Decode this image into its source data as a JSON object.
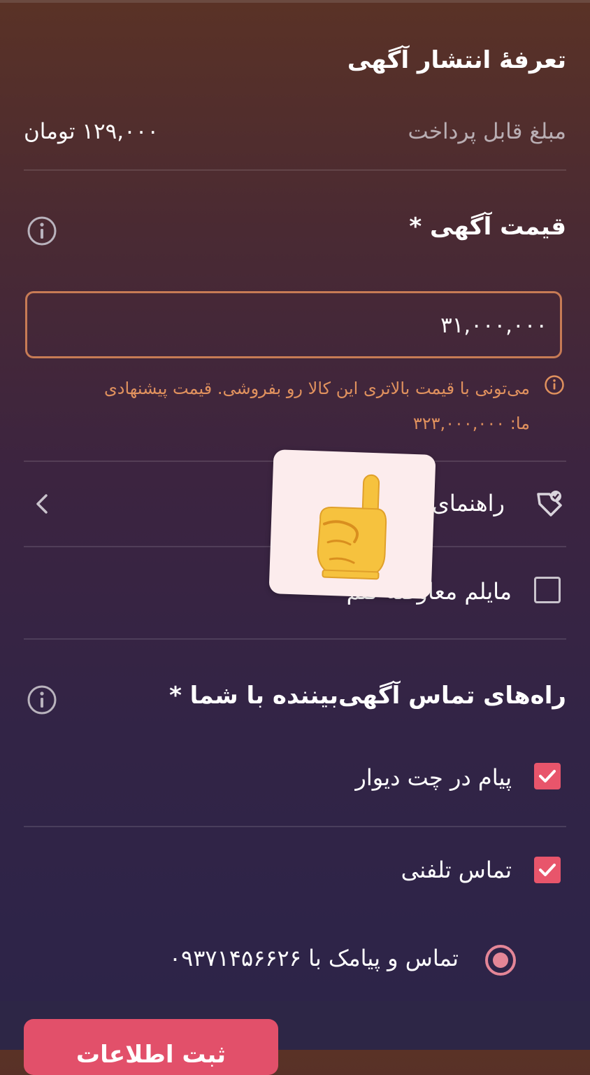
{
  "header": {
    "title": "تعرفهٔ انتشار آگهی"
  },
  "payment": {
    "label": "مبلغ قابل پرداخت",
    "value": "۱۲۹,۰۰۰ تومان"
  },
  "price": {
    "title": "قیمت آگهی *",
    "value": "۳۱,۰۰۰,۰۰۰",
    "hint": "می‌تونی با قیمت بالاتری این کالا رو بفروشی. قیمت پیشنهادی ما: ۳۲۳,۰۰۰,۰۰۰"
  },
  "guide": {
    "label": "راهنمای"
  },
  "exchange": {
    "label": "مایلم معاوضه کنم",
    "checked": false
  },
  "contact": {
    "title": "راه‌های تماس آگهی‌بیننده با شما *",
    "chat_label": "پیام در چت دیوار",
    "chat_checked": true,
    "phone_label": "تماس تلفنی",
    "phone_checked": true,
    "phone_option_label": "تماس و پیامک با ۰۹۳۷۱۴۵۶۶۲۶"
  },
  "footer": {
    "submit_label": "ثبت اطلاعات"
  },
  "colors": {
    "accent": "#e2506a",
    "warning": "#e0915e",
    "input_border": "#c77b55"
  },
  "icons": [
    "info-icon",
    "tag-heart-icon",
    "chevron-left-icon",
    "check-icon",
    "pointing-hand-icon"
  ]
}
